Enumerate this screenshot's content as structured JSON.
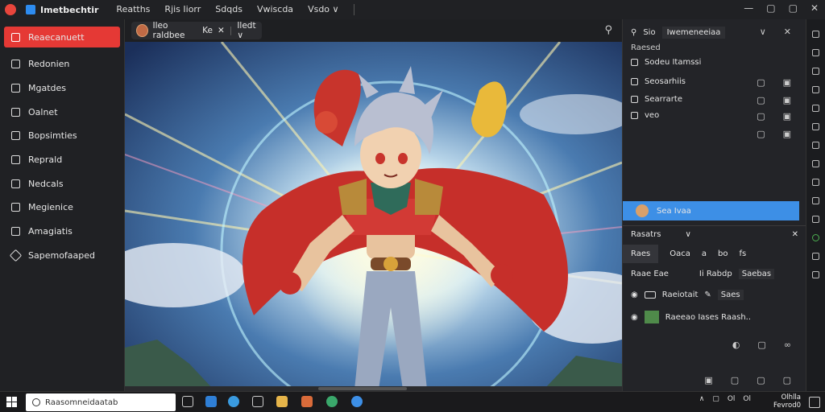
{
  "titlebar": {
    "app_title": "Imetbechtir",
    "menus": [
      "Reatths",
      "Rjis Iiorr",
      "Sdqds",
      "Vwiscda",
      "Vsdo"
    ],
    "menu_dropdown_glyph": "∨",
    "window_controls": [
      "—",
      "▢",
      "▢",
      "✕"
    ]
  },
  "sidebar": {
    "items": [
      {
        "label": "Reaecanuett",
        "icon": "image-icon",
        "active": true
      },
      {
        "label": "Redonien",
        "icon": "layers-icon"
      },
      {
        "label": "Mgatdes",
        "icon": "document-icon"
      },
      {
        "label": "Oalnet",
        "icon": "palette-icon"
      },
      {
        "label": "Bopsimties",
        "icon": "properties-icon"
      },
      {
        "label": "Reprald",
        "icon": "play-icon"
      },
      {
        "label": "Nedcals",
        "icon": "grid-icon"
      },
      {
        "label": "Megienice",
        "icon": "image-list-icon"
      },
      {
        "label": "Amagiatis",
        "icon": "frame-icon"
      },
      {
        "label": "Sapemofaaped",
        "icon": "brush-icon"
      }
    ]
  },
  "canvas_header": {
    "tab_label": "Ileo raldbee",
    "tab_extra": "Ke",
    "tab_close": "✕",
    "zoom_label": "Iledt",
    "zoom_caret": "∨",
    "search_glyph": "⚲"
  },
  "right_panel": {
    "search_label": "Sio",
    "search_box_text": "Iwemeneeiaa",
    "header_glyphs": [
      "∨",
      "✕"
    ],
    "subtitle": "Raesed",
    "rows": [
      {
        "label": "Sodeu Itamssi",
        "icon": "square-icon"
      },
      {
        "label": "Seosarhiis",
        "icon": "square-icon"
      },
      {
        "label": "Searrarte",
        "icon": "square-icon"
      },
      {
        "label": "veo",
        "icon": "square-icon"
      }
    ],
    "selected_row": "Sea Ivaa",
    "lower_header": "Rasatrs",
    "lower_header_glyph": "∨",
    "lower_header_close": "✕",
    "tabs": [
      "Raes",
      "Oaca",
      "a",
      "bo",
      "fs"
    ],
    "props_row1_left": "Raae Eae",
    "props_row1_right": "Ii Rabdp",
    "props_row1_value": "Saebas",
    "layer1_label": "Raeiotait",
    "layer1_value": "Saes",
    "layer2_label": "Raeeao Iases Raash..",
    "bottom_glyphs": [
      "▣",
      "▢",
      "▢",
      "▢"
    ]
  },
  "taskbar": {
    "search_placeholder": "Raasomneidaatab",
    "tray_text1": "Ol",
    "tray_text2": "Ol",
    "clock_time": "Olhlla",
    "clock_date": "Fevrod0"
  },
  "colors": {
    "accent_red": "#e53935",
    "accent_blue": "#3d8fe6",
    "bg_dark": "#202124"
  }
}
